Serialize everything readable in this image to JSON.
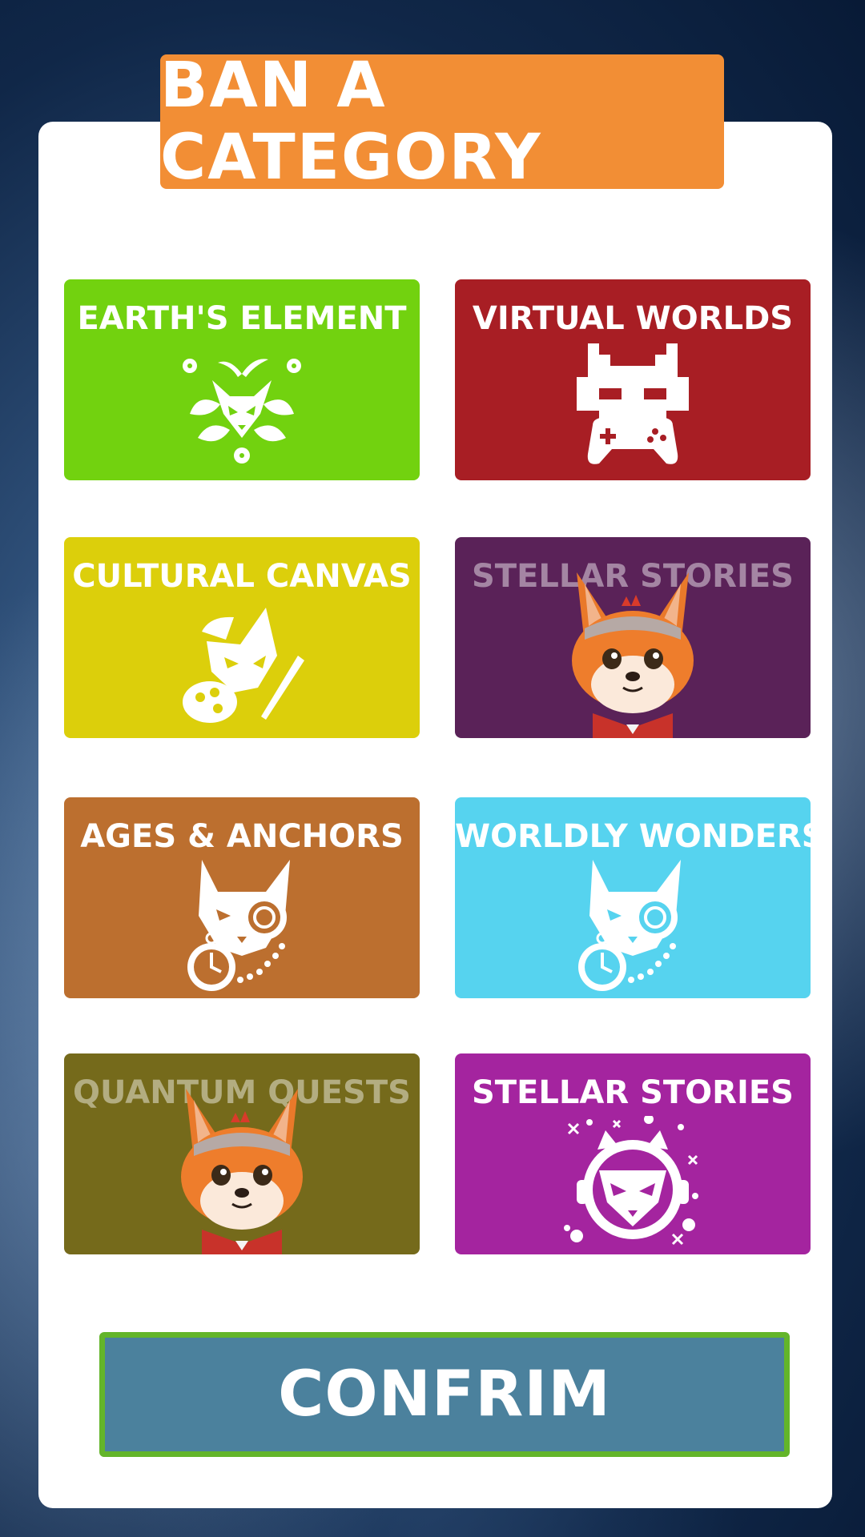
{
  "title": "BAN A CATEGORY",
  "tiles": [
    {
      "label": "EARTH'S ELEMENT",
      "color": "#72d20f",
      "icon": "leaf-fox-icon",
      "state": "available"
    },
    {
      "label": "VIRTUAL WORLDS",
      "color": "#a81e24",
      "icon": "pixel-fox-gamepad-icon",
      "state": "available"
    },
    {
      "label": "CULTURAL CANVAS",
      "color": "#dccf0b",
      "icon": "artist-fox-palette-icon",
      "state": "available"
    },
    {
      "label": "STELLAR STORIES",
      "color": "#5a2258",
      "icon": "fox-mascot-icon",
      "state": "banned"
    },
    {
      "label": "AGES & ANCHORS",
      "color": "#bc6f2f",
      "icon": "fox-monocle-pocketwatch-icon",
      "state": "available"
    },
    {
      "label": "WORLDLY WONDERS",
      "color": "#56d3ef",
      "icon": "fox-monocle-pocketwatch-icon",
      "state": "available"
    },
    {
      "label": "QUANTUM QUESTS",
      "color": "#756a1b",
      "icon": "fox-mascot-icon",
      "state": "banned"
    },
    {
      "label": "STELLAR STORIES",
      "color": "#a4249f",
      "icon": "astronaut-fox-icon",
      "state": "available"
    }
  ],
  "confirm_label": "CONFRIM",
  "colors": {
    "title_banner": "#f28e35",
    "confirm_bg": "#4b819d",
    "confirm_border": "#63b52a"
  }
}
